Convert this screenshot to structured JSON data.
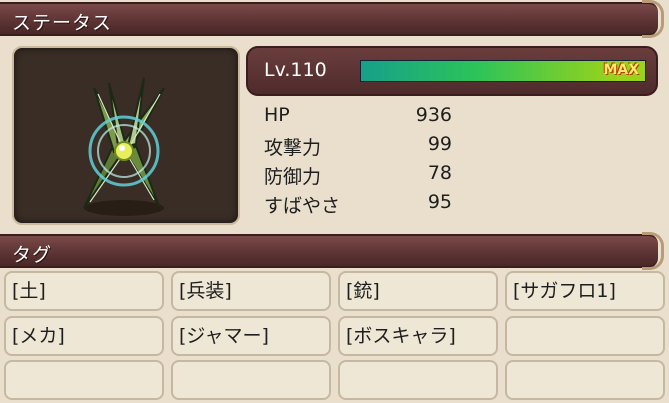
{
  "status_header": {
    "title": "ステータス"
  },
  "stats": {
    "level": "Lv.110",
    "exp_fraction": 1.0,
    "max_label": "MAX",
    "rows": [
      {
        "name": "HP",
        "value": "936"
      },
      {
        "name": "攻撃力",
        "value": "99"
      },
      {
        "name": "防御力",
        "value": "78"
      },
      {
        "name": "すばやさ",
        "value": "95"
      }
    ]
  },
  "tags_header": {
    "title": "タグ"
  },
  "tags": [
    "[土]",
    "[兵装]",
    "[銃]",
    "[サガフロ1]",
    "[メカ]",
    "[ジャマー]",
    "[ボスキャラ]",
    "",
    "",
    "",
    "",
    ""
  ]
}
